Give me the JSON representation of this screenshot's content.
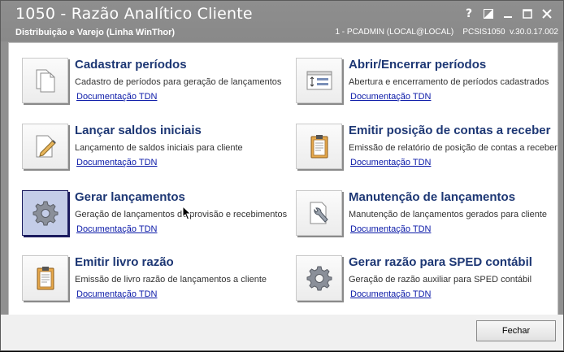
{
  "window": {
    "title": "1050 - Razão Analítico Cliente",
    "subtitle": "Distribuição e Varejo (Linha WinThor)",
    "info": "1 - PCADMIN (LOCAL@LOCAL)    PCSIS1050  v.30.0.17.002",
    "help_glyph": "?"
  },
  "cards": [
    {
      "title": "Cadastrar períodos",
      "desc": "Cadastro de períodos para geração de lançamentos",
      "link": "Documentação TDN",
      "icon": "documents-icon"
    },
    {
      "title": "Abrir/Encerrar períodos",
      "desc": "Abertura e encerramento de períodos cadastrados",
      "link": "Documentação TDN",
      "icon": "calendar-period-icon"
    },
    {
      "title": "Lançar saldos iniciais",
      "desc": "Lançamento de saldos iniciais para cliente",
      "link": "Documentação TDN",
      "icon": "edit-document-icon"
    },
    {
      "title": "Emitir posição de contas a receber",
      "desc": "Emissão de relatório de posição de contas a receber",
      "link": "Documentação TDN",
      "icon": "clipboard-icon"
    },
    {
      "title": "Gerar lançamentos",
      "desc": "Geração de lançamentos de provisão e recebimentos",
      "link": "Documentação TDN",
      "icon": "gear-icon"
    },
    {
      "title": "Manutenção de lançamentos",
      "desc": "Manutenção de lançamentos gerados para cliente",
      "link": "Documentação TDN",
      "icon": "wrench-document-icon"
    },
    {
      "title": "Emitir livro razão",
      "desc": "Emissão de livro razão de lançamentos a cliente",
      "link": "Documentação TDN",
      "icon": "clipboard-icon"
    },
    {
      "title": "Gerar razão para SPED contábil",
      "desc": "Geração de razão auxiliar para SPED contábil",
      "link": "Documentação TDN",
      "icon": "gear-icon"
    }
  ],
  "footer": {
    "close_label": "Fechar"
  }
}
